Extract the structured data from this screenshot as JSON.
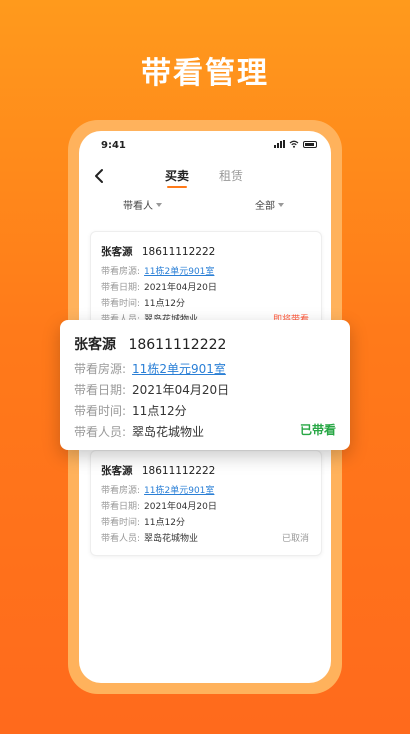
{
  "headline": "带看管理",
  "status_bar": {
    "time": "9:41"
  },
  "nav": {
    "tabs": [
      "买卖",
      "租赁"
    ]
  },
  "filters": [
    "带看人",
    "全部"
  ],
  "labels": {
    "house": "带看房源:",
    "date": "带看日期:",
    "time": "带看时间:",
    "person": "带看人员:"
  },
  "records": [
    {
      "client": "张客源",
      "phone": "18611112222",
      "house": "11栋2单元901室",
      "date": "2021年04月20日",
      "time": "11点12分",
      "person": "翠岛花城物业",
      "status": "即将带看"
    },
    {
      "client": "张客源",
      "phone": "18611112222",
      "house": "11栋2单元901室",
      "date": "2021年04月20日",
      "time": "11点12分",
      "person": "翠岛花城物业",
      "status": "已带看"
    },
    {
      "client": "张客源",
      "phone": "18611112222",
      "house": "11栋2单元901室",
      "date": "2021年04月20日",
      "time": "11点12分",
      "person": "翠岛花城物业",
      "status": "已取消"
    }
  ],
  "colors": {
    "brand_orange": "#ff7a1a",
    "link_blue": "#2a7fd6",
    "status_done": "#28a745",
    "status_upcoming": "#ff5a3c",
    "status_cancelled": "#999999"
  }
}
